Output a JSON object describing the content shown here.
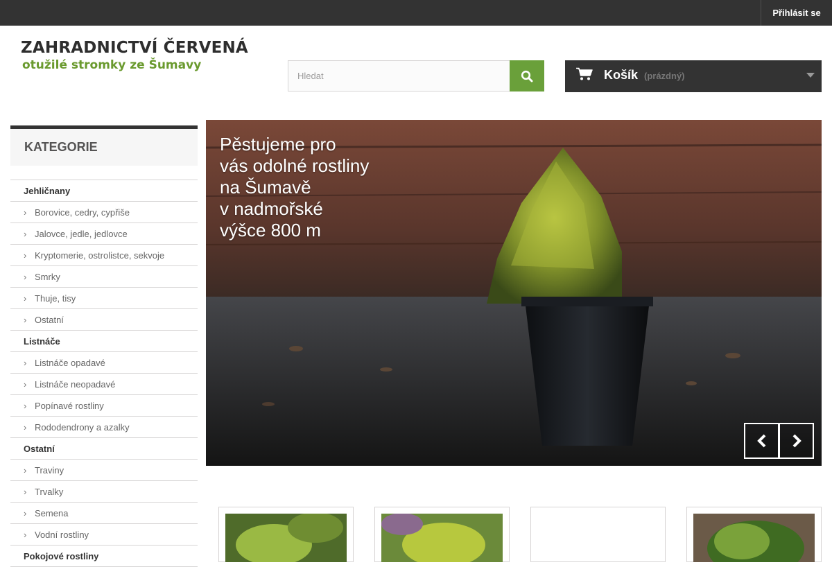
{
  "topbar": {
    "login_label": "Přihlásit se"
  },
  "logo": {
    "title": "ZAHRADNICTVÍ ČERVENÁ",
    "subtitle": "otužilé stromky ze Šumavy"
  },
  "search": {
    "placeholder": "Hledat",
    "button_icon": "search-icon"
  },
  "cart": {
    "label": "Košík",
    "status": "(prázdný)",
    "icon": "cart-icon"
  },
  "sidebar": {
    "heading": "KATEGORIE",
    "items": [
      {
        "label": "Jehličnany",
        "level": "top"
      },
      {
        "label": "Borovice, cedry, cypřiše",
        "level": "sub"
      },
      {
        "label": "Jalovce, jedle, jedlovce",
        "level": "sub"
      },
      {
        "label": "Kryptomerie, ostrolistce, sekvoje",
        "level": "sub"
      },
      {
        "label": "Smrky",
        "level": "sub"
      },
      {
        "label": "Thuje, tisy",
        "level": "sub"
      },
      {
        "label": "Ostatní",
        "level": "sub"
      },
      {
        "label": "Listnáče",
        "level": "top"
      },
      {
        "label": "Listnáče opadavé",
        "level": "sub"
      },
      {
        "label": "Listnáče neopadavé",
        "level": "sub"
      },
      {
        "label": "Popínavé rostliny",
        "level": "sub"
      },
      {
        "label": "Rododendrony a azalky",
        "level": "sub"
      },
      {
        "label": "Ostatní",
        "level": "top"
      },
      {
        "label": "Traviny",
        "level": "sub"
      },
      {
        "label": "Trvalky",
        "level": "sub"
      },
      {
        "label": "Semena",
        "level": "sub"
      },
      {
        "label": "Vodní rostliny",
        "level": "sub"
      },
      {
        "label": "Pokojové rostliny",
        "level": "top"
      }
    ]
  },
  "slider": {
    "caption": "Pěstujeme pro\nvás odolné rostliny\nna Šumavě\nv nadmořské\nvýšce 800 m",
    "prev_icon": "chevron-left-icon",
    "next_icon": "chevron-right-icon"
  },
  "colors": {
    "dark": "#333333",
    "accent_green": "#6aa03a",
    "logo_green": "#6a9a2e"
  }
}
